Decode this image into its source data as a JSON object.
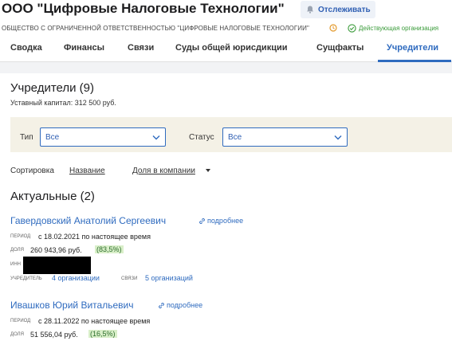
{
  "header": {
    "title": "ООО \"Цифровые Налоговые Технологии\"",
    "track_label": "Отслеживать",
    "legal_name": "ОБЩЕСТВО С ОГРАНИЧЕННОЙ ОТВЕТСТВЕННОСТЬЮ \"ЦИФРОВЫЕ НАЛОГОВЫЕ ТЕХНОЛОГИИ\"",
    "status": "Действующая организация"
  },
  "tabs": [
    {
      "label": "Сводка"
    },
    {
      "label": "Финансы"
    },
    {
      "label": "Связи"
    },
    {
      "label": "Суды общей юрисдикции"
    },
    {
      "label": "Сущфакты"
    },
    {
      "label": "Учредители",
      "active": true
    }
  ],
  "founders": {
    "title": "Учредители (9)",
    "capital": "Уставный капитал: 312 500 руб.",
    "filters": {
      "type_label": "Тип",
      "type_value": "Все",
      "status_label": "Статус",
      "status_value": "Все"
    },
    "sort": {
      "label": "Сортировка",
      "by_name": "Название",
      "by_share": "Доля в компании"
    },
    "actual_title": "Актуальные (2)",
    "more_label": "подробнее",
    "labels": {
      "period": "ПЕРИОД",
      "share": "ДОЛЯ",
      "inn": "ИНН",
      "founder": "УЧРЕДИТЕЛЬ",
      "links": "СВЯЗИ"
    },
    "people": [
      {
        "name": "Гавердовский Анатолий Сергеевич",
        "period": "с 18.02.2021 по настоящее время",
        "share_amount": "260 943,96 руб.",
        "share_percent": "(83,5%)",
        "founder_of": "4 организации",
        "links": "5 организаций"
      },
      {
        "name": "Ивашков Юрий Витальевич",
        "period": "с 28.11.2022 по настоящее время",
        "share_amount": "51 556,04 руб.",
        "share_percent": "(16,5%)"
      }
    ]
  },
  "colors": {
    "accent": "#2f6bbf",
    "status_green": "#3a9b3a",
    "share_badge_bg": "#d9efc9",
    "filter_bg": "#f4f1e6"
  }
}
